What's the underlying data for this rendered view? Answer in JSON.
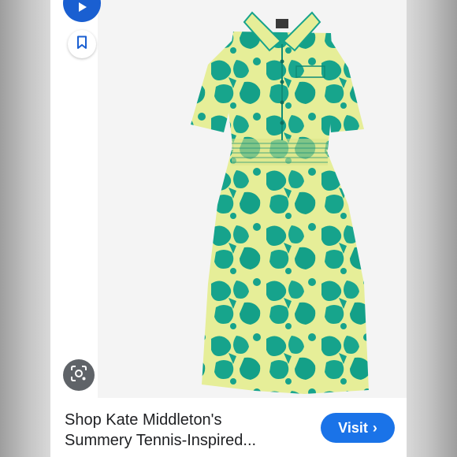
{
  "result": {
    "title_line1": "Shop Kate Middleton's",
    "title_line2": "Summery Tennis-Inspired...",
    "visit_label": "Visit",
    "visit_chevron": "›"
  },
  "icons": {
    "top_button": "play-icon",
    "bookmark": "bookmark-icon",
    "lens": "lens-search-icon"
  },
  "colors": {
    "accent": "#1a73e8",
    "dress_base": "#e6ee98",
    "dress_print": "#16a38c"
  }
}
